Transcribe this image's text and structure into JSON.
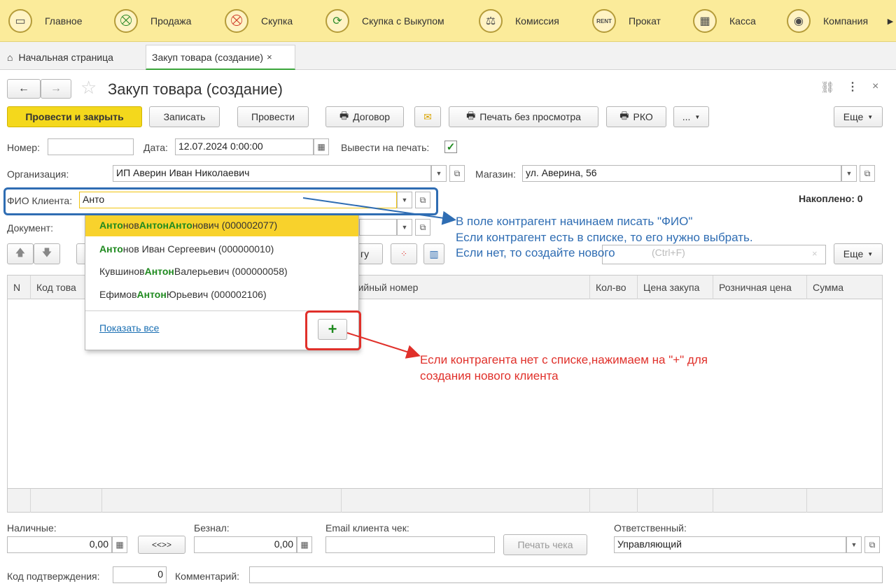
{
  "sections": [
    {
      "label": "Главное",
      "icon": "monitor-icon",
      "glyph": "▭"
    },
    {
      "label": "Продажа",
      "icon": "cart-icon",
      "glyph": "🛒"
    },
    {
      "label": "Скупка",
      "icon": "cart-down-icon",
      "glyph": "🛒"
    },
    {
      "label": "Скупка с Выкупом",
      "icon": "cycle-icon",
      "glyph": "⟳"
    },
    {
      "label": "Комиссия",
      "icon": "scales-icon",
      "glyph": "⚖"
    },
    {
      "label": "Прокат",
      "icon": "rent-icon",
      "glyph": "RENT"
    },
    {
      "label": "Касса",
      "icon": "cash-register-icon",
      "glyph": "▦"
    },
    {
      "label": "Компания",
      "icon": "company-icon",
      "glyph": "◉"
    }
  ],
  "tabs": {
    "home": "Начальная страница",
    "current": "Закуп товара (создание)",
    "close": "×"
  },
  "form": {
    "title": "Закуп товара (создание)",
    "toolbar": {
      "post_close": "Провести и закрыть",
      "save": "Записать",
      "post": "Провести",
      "contract": "Договор",
      "print_no_preview": "Печать без просмотра",
      "rko": "РКО",
      "more_dots": "...",
      "more": "Еще"
    },
    "number_label": "Номер:",
    "number_value": "",
    "date_label": "Дата:",
    "date_value": "12.07.2024  0:00:00",
    "print_label": "Вывести на печать:",
    "org_label": "Организация:",
    "org_value": "ИП Аверин Иван Николаевич",
    "shop_label": "Магазин:",
    "shop_value": "ул. Аверина, 56",
    "client_label": "ФИО Клиента:",
    "client_value": "Анто",
    "accum_label": "Накоплено: 0",
    "doc_label": "Документ:",
    "table_btn_partial": "гу",
    "search_hint": "(Ctrl+F)",
    "table_more": "Еще"
  },
  "table": {
    "columns": [
      "N",
      "Код това",
      "ерийный номер",
      "Кол-во",
      "Цена закупа",
      "Розничная цена",
      "Сумма"
    ]
  },
  "dropdown": {
    "items": [
      {
        "parts": [
          [
            "Анто",
            true
          ],
          [
            "нов ",
            false
          ],
          [
            "Антон",
            true
          ],
          [
            " ",
            false
          ],
          [
            "Анто",
            true
          ],
          [
            "нович (000002077)",
            false
          ]
        ]
      },
      {
        "parts": [
          [
            "Анто",
            true
          ],
          [
            "нов Иван Сергеевич (000000010)",
            false
          ]
        ]
      },
      {
        "parts": [
          [
            "Кувшинов ",
            false
          ],
          [
            "Антон",
            true
          ],
          [
            " Валерьевич (000000058)",
            false
          ]
        ]
      },
      {
        "parts": [
          [
            "Ефимов ",
            false
          ],
          [
            "Антон",
            true
          ],
          [
            " Юрьевич (000002106)",
            false
          ]
        ]
      }
    ],
    "show_all": "Показать все",
    "plus": "+"
  },
  "notes": {
    "blue": [
      "В поле контрагент начинаем писать \"ФИО\"",
      "Если контрагент есть в списке, то его нужно выбрать.",
      "Если нет, то создайте нового"
    ],
    "red": [
      "Если контрагента нет с списке,нажимаем на \"+\" для",
      "создания нового клиента"
    ]
  },
  "footer": {
    "cash_label": "Наличные:",
    "cash_value": "0,00",
    "swap": "<<>>",
    "card_label": "Безнал:",
    "card_value": "0,00",
    "email_label": "Email клиента чек:",
    "email_value": "",
    "print_check": "Печать чека",
    "resp_label": "Ответственный:",
    "resp_value": "Управляющий",
    "confirm_label": "Код подтверждения:",
    "confirm_value": "0",
    "comment_label": "Комментарий:",
    "comment_value": ""
  },
  "colors": {
    "accent": "#f4d81c",
    "highlight": "#1f8a1f",
    "annotation_blue": "#2f6db3",
    "annotation_red": "#e0302a"
  }
}
